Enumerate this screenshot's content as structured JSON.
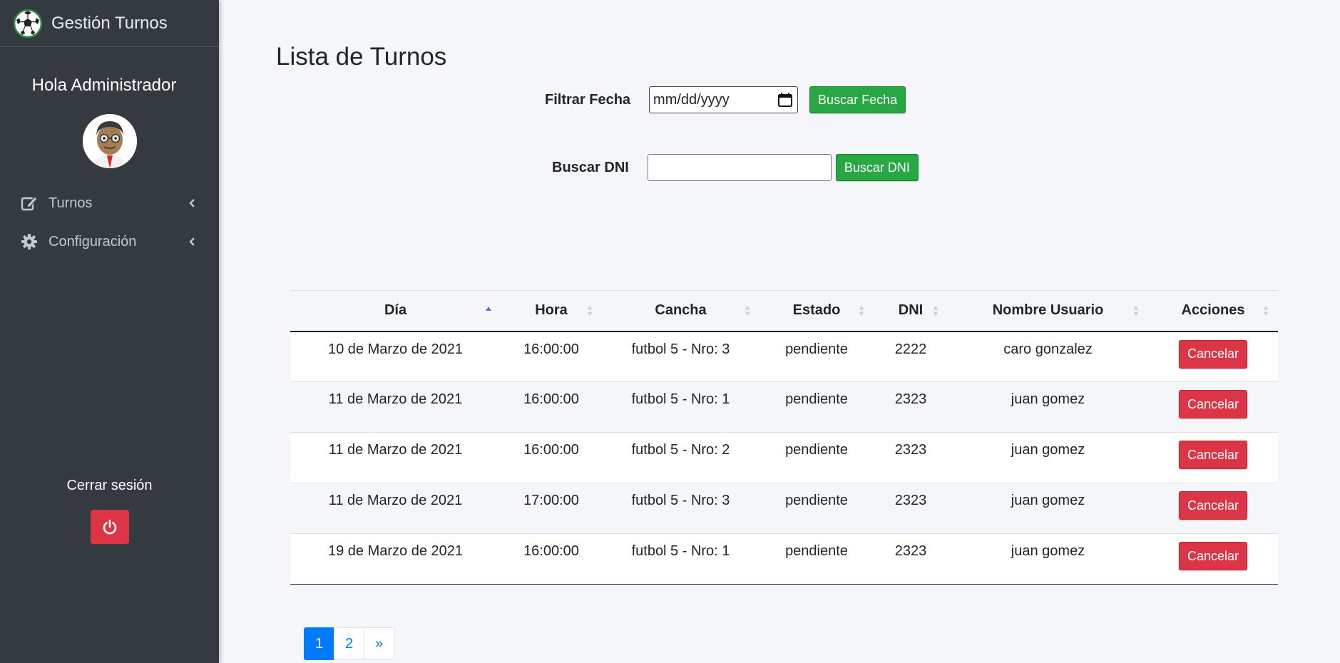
{
  "sidebar": {
    "brand": "Gestión Turnos",
    "greeting": "Hola Administrador",
    "items": [
      {
        "label": "Turnos"
      },
      {
        "label": "Configuración"
      }
    ],
    "logout_label": "Cerrar sesión"
  },
  "main": {
    "title": "Lista de Turnos",
    "filter_date": {
      "label": "Filtrar Fecha",
      "placeholder": "mm/dd/yyyy",
      "button": "Buscar Fecha"
    },
    "filter_dni": {
      "label": "Buscar DNI",
      "value": "",
      "button": "Buscar DNI"
    }
  },
  "table": {
    "columns": [
      "Día",
      "Hora",
      "Cancha",
      "Estado",
      "DNI",
      "Nombre Usuario",
      "Acciones"
    ],
    "sorted_column": "Día",
    "sort_direction": "asc",
    "rows": [
      {
        "dia": "10 de Marzo de 2021",
        "hora": "16:00:00",
        "cancha": "futbol 5 - Nro: 3",
        "estado": "pendiente",
        "dni": "2222",
        "nombre": "caro gonzalez",
        "accion": "Cancelar"
      },
      {
        "dia": "11 de Marzo de 2021",
        "hora": "16:00:00",
        "cancha": "futbol 5 - Nro: 1",
        "estado": "pendiente",
        "dni": "2323",
        "nombre": "juan gomez",
        "accion": "Cancelar"
      },
      {
        "dia": "11 de Marzo de 2021",
        "hora": "16:00:00",
        "cancha": "futbol 5 - Nro: 2",
        "estado": "pendiente",
        "dni": "2323",
        "nombre": "juan gomez",
        "accion": "Cancelar"
      },
      {
        "dia": "11 de Marzo de 2021",
        "hora": "17:00:00",
        "cancha": "futbol 5 - Nro: 3",
        "estado": "pendiente",
        "dni": "2323",
        "nombre": "juan gomez",
        "accion": "Cancelar"
      },
      {
        "dia": "19 de Marzo de 2021",
        "hora": "16:00:00",
        "cancha": "futbol 5 - Nro: 1",
        "estado": "pendiente",
        "dni": "2323",
        "nombre": "juan gomez",
        "accion": "Cancelar"
      }
    ]
  },
  "pagination": {
    "pages": [
      "1",
      "2"
    ],
    "current": "1",
    "next": "»"
  },
  "icons": {
    "brand": "soccer-ball-icon",
    "turnos": "edit-icon",
    "configuracion": "gear-icon",
    "chevron": "chevron-left-icon",
    "logout": "power-icon",
    "date_picker": "calendar-icon",
    "sort": "sort-icon"
  },
  "colors": {
    "sidebar": "#343a40",
    "success": "#28a745",
    "danger": "#dc3545",
    "primary": "#007bff",
    "background": "#f4f6f9"
  }
}
